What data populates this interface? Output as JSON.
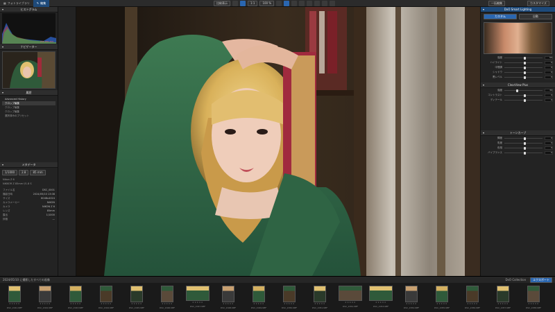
{
  "topbar": {
    "library_tab": "フォトライブラリ",
    "customize_tab": "編集",
    "compare_label": "比較表示",
    "zoom_value": "1:1",
    "fit_label": "100 %",
    "export_button": "一括編集",
    "workspace_label": "カスタマイズ"
  },
  "left_panel": {
    "histogram_title": "ヒストグラム",
    "histogram_values": "255 255 255",
    "navigator_title": "ナビゲーター",
    "history_title": "履歴",
    "history_items": [
      "Advanced History",
      "クロップ編集",
      "クロップ編集",
      "クロップ編集",
      "選択済みのプリセット"
    ],
    "metadata_title": "メタデータ",
    "exif_rows": [
      {
        "k": "ISO",
        "v": "1/1000"
      },
      {
        "k": "F",
        "v": "2.8"
      },
      {
        "k": "焦点距離",
        "v": "85 mm"
      }
    ],
    "camera": "Nikon Z 6",
    "lens": "NIKKOR Z 85mm f/1.8 S",
    "meta_rows": [
      {
        "k": "ファイル名",
        "v": "DSC_0001"
      },
      {
        "k": "撮影日時",
        "v": "2024/05/10 13:08"
      },
      {
        "k": "サイズ",
        "v": "6048x4024"
      },
      {
        "k": "カメラメーカー",
        "v": "NIKON"
      },
      {
        "k": "カメラ",
        "v": "NIKON Z 6"
      },
      {
        "k": "レンズ",
        "v": "85mm"
      },
      {
        "k": "露出",
        "v": "1/1000"
      },
      {
        "k": "評価",
        "v": "—"
      }
    ]
  },
  "right_panel": {
    "title": "DxO Smart Lighting",
    "mode_a": "カスタム",
    "mode_b": "自動",
    "sliders": [
      {
        "label": "強度",
        "value": "50",
        "pos": 0.5
      },
      {
        "label": "ハイライト",
        "value": "0",
        "pos": 0.5
      },
      {
        "label": "中間調",
        "value": "0",
        "pos": 0.5
      },
      {
        "label": "シャドウ",
        "value": "0",
        "pos": 0.5
      },
      {
        "label": "黒レベル",
        "value": "0",
        "pos": 0.5
      }
    ],
    "section2_title": "ClearView Plus",
    "sliders2": [
      {
        "label": "強度",
        "value": "30",
        "pos": 0.3
      },
      {
        "label": "コントラスト",
        "value": "0",
        "pos": 0.5
      },
      {
        "label": "ディテール",
        "value": "0",
        "pos": 0.5
      }
    ],
    "section3_title": "トーンカーブ",
    "sliders3": [
      {
        "label": "輝度",
        "value": "0",
        "pos": 0.5
      },
      {
        "label": "彩度",
        "value": "0",
        "pos": 0.5
      },
      {
        "label": "色相",
        "value": "0",
        "pos": 0.5
      },
      {
        "label": "バイブランス",
        "value": "0",
        "pos": 0.5
      }
    ]
  },
  "photo": {
    "info_left": "画像情報",
    "info_right": "ズーム"
  },
  "filmstrip": {
    "count_label": "2024/05/10 に撮影したすべての画像",
    "filter_label": "DxO Collection",
    "export_button": "エクスポート",
    "thumbs": [
      "DSC_2041.NEF",
      "DSC_2042.NEF",
      "DSC_2043.NEF",
      "DSC_2044.NEF",
      "DSC_2045.NEF",
      "DSC_2046.NEF",
      "DSC_2047.NEF",
      "DSC_2048.NEF",
      "DSC_2049.NEF",
      "DSC_2050.NEF",
      "DSC_2051.NEF",
      "DSC_2052.NEF",
      "DSC_2053.NEF",
      "DSC_2054.NEF",
      "DSC_2055.NEF",
      "DSC_2056.NEF",
      "DSC_2057.NEF",
      "DSC_2058.NEF"
    ]
  }
}
